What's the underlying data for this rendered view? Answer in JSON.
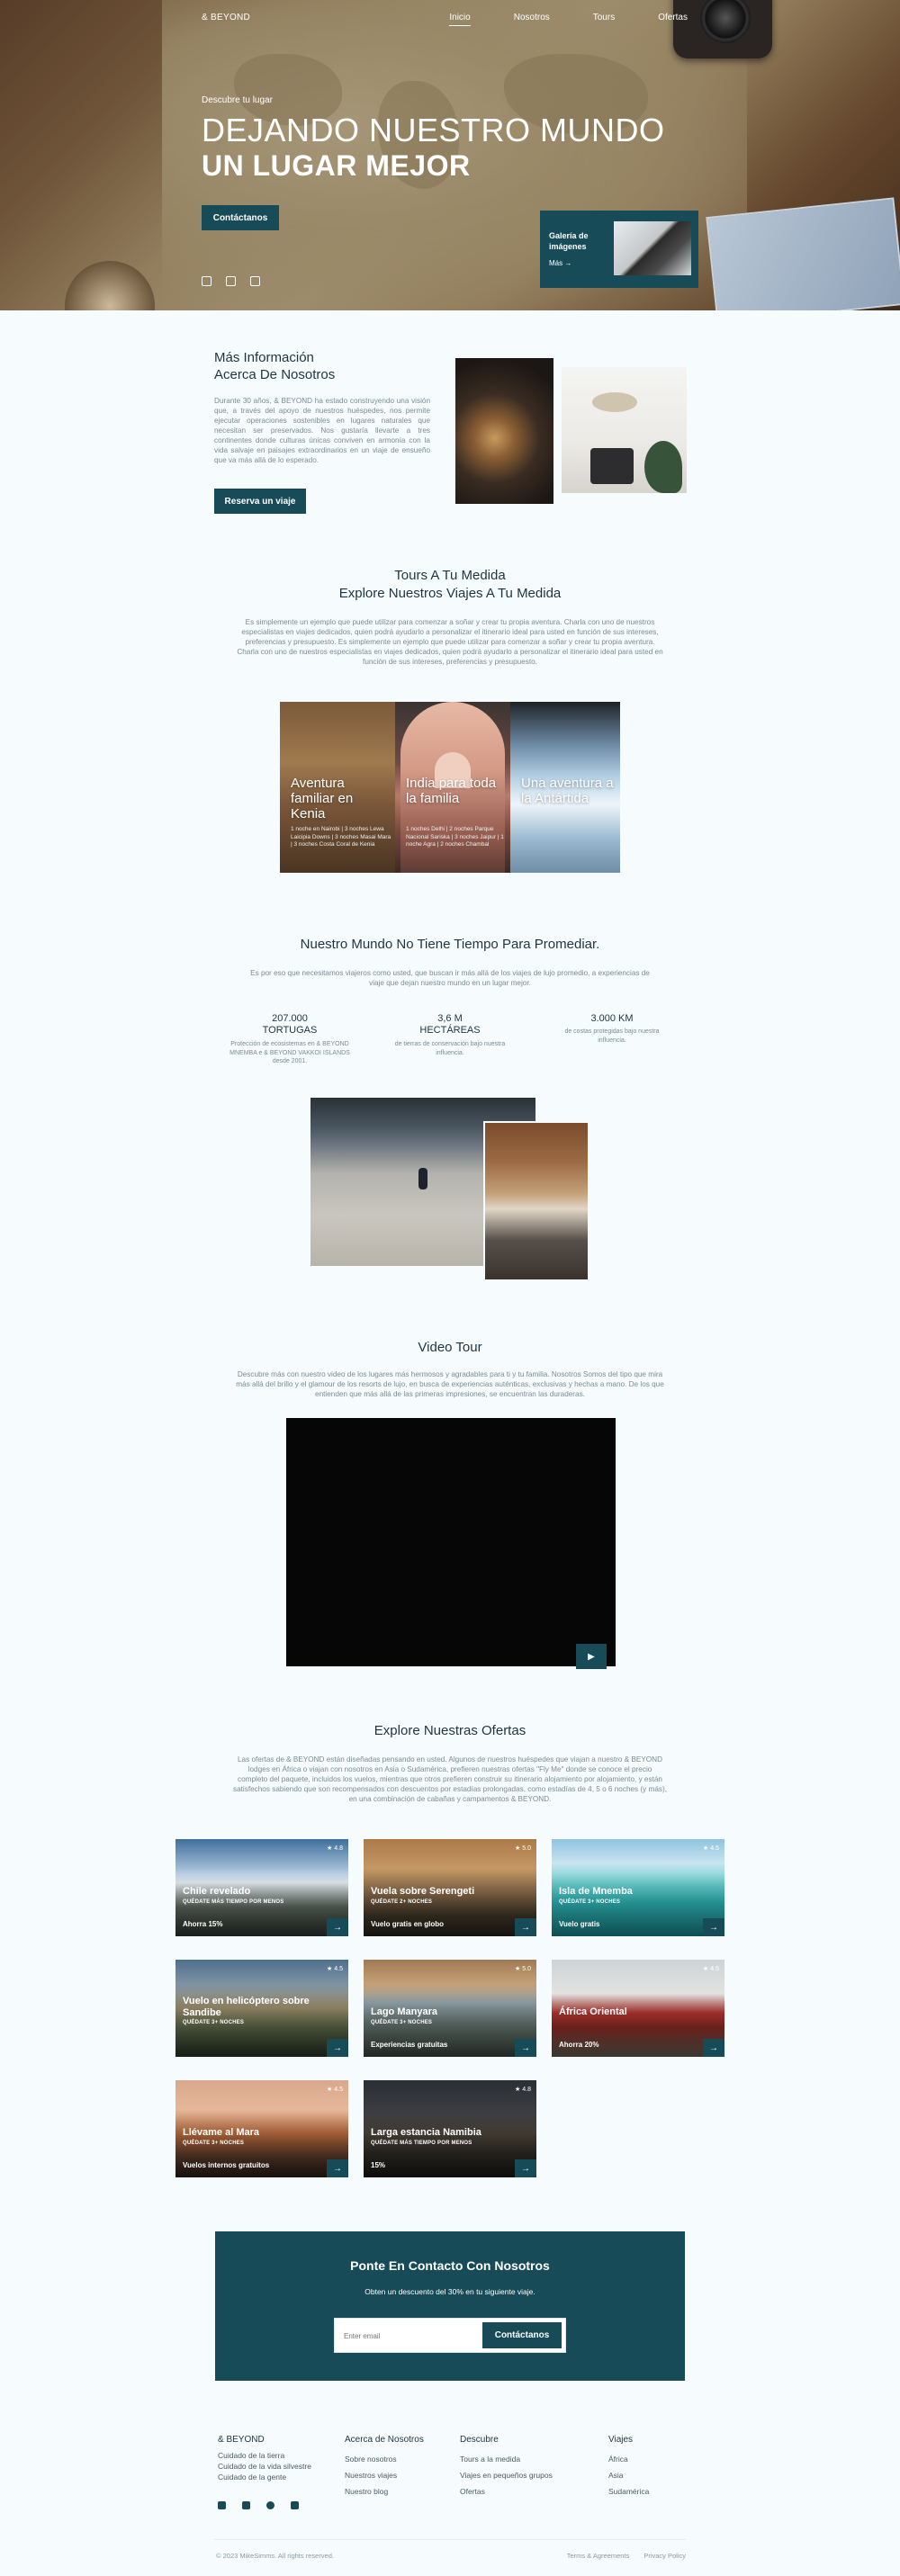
{
  "nav": {
    "brand": "& BEYOND",
    "links": [
      "Inicio",
      "Nosotros",
      "Tours",
      "Ofertas"
    ]
  },
  "hero": {
    "eyebrow": "Descubre tu lugar",
    "title_line1": "DEJANDO NUESTRO MUNDO",
    "title_line2": "UN LUGAR MEJOR",
    "cta": "Contáctanos",
    "gallery": {
      "title": "Galería de imágenes",
      "more": "Más  →"
    }
  },
  "about": {
    "title_line1": "Más Información",
    "title_line2": "Acerca De Nosotros",
    "text": "Durante 30 años, & BEYOND ha estado construyendo una visión que, a través del apoyo de nuestros huéspedes, nos permite ejecutar operaciones sostenibles en lugares naturales que necesitan ser preservados. Nos gustaría llevarte a tres continentes donde culturas únicas conviven en armonía con la vida salvaje en paisajes extraordinarios en un viaje de ensueño que va más allá de lo esperado.",
    "button": "Reserva un viaje"
  },
  "tours": {
    "title_line1": "Tours A Tu Medida",
    "title_line2": "Explore Nuestros Viajes A Tu Medida",
    "text": "Es simplemente un ejemplo que puede utilizar para comenzar a soñar y crear tu propia aventura. Charla con uno de nuestros especialistas en viajes dedicados, quien podrá ayudarlo a personalizar el itinerario ideal para usted en función de sus intereses, preferencias y presupuesto. Es simplemente un ejemplo que puede utilizar para comenzar a soñar y crear tu propia aventura. Charla con uno de nuestros especialistas en viajes dedicados, quien podrá ayudarlo a personalizar el itinerario ideal para usted en función de sus intereses, preferencias y presupuesto.",
    "cards": [
      {
        "title": "Aventura familiar en Kenia",
        "desc": "1 noche en Nairobi | 3 noches Lewa Laicipia Downs | 3 noches Masai Mara | 3 noches Costa Coral de Kenia"
      },
      {
        "title": "India para toda la familia",
        "desc": "1 noches Delhi | 2 noches Parque Nacional Sariska | 3 noches Jaipur | 1 noche Agra | 2 noches Chambal"
      },
      {
        "title": "Una aventura a la Antártida",
        "desc": ""
      }
    ]
  },
  "stats": {
    "title": "Nuestro Mundo No Tiene Tiempo Para Promediar.",
    "text": "Es por eso que necesitamos viajeros como usted, que buscan ir más allá de los viajes de lujo promedio, a experiencias de viaje que dejan nuestro mundo en un lugar mejor.",
    "items": [
      {
        "value": "207.000",
        "unit": "TORTUGAS",
        "desc": "Protección de ecosistemas en & BEYOND MNEMBA e & BEYOND VAKKOI ISLANDS desde 2001."
      },
      {
        "value": "3,6 M",
        "unit": "HECTÁREAS",
        "desc": "de tierras de conservación bajo nuestra influencia."
      },
      {
        "value": "3.000 KM",
        "unit": "",
        "desc": "de costas protegidas bajo nuestra influencia."
      }
    ]
  },
  "video": {
    "title": "Video Tour",
    "text": "Descubre más con nuestro video de los lugares más hermosos y agradables para ti y tu familia. Nosotros Somos del tipo que mira más allá del brillo y el glamour de los resorts de lujo, en busca de experiencias auténticas, exclusivas y hechas a mano. De los que entienden que más allá de las primeras impresiones, se encuentran las duraderas.",
    "play": "▶"
  },
  "offers": {
    "title": "Explore Nuestras Ofertas",
    "text": "Las ofertas de & BEYOND están diseñadas pensando en usted. Algunos de nuestros huéspedes que viajan a nuestro & BEYOND lodges en África o viajan con nosotros en Asia o Sudamérica, prefieren nuestras ofertas \"Fly Me\" donde se conoce el precio completo del paquete, incluidos los vuelos, mientras que otros prefieren construir su itinerario alojamiento por alojamiento, y están satisfechos sabiendo que son recompensados con descuentos por estadías prolongadas, como estadías de 4, 5 o 6 noches (y más), en una combinación de cabañas y campamentos & BEYOND.",
    "items": [
      {
        "rating": "★ 4.8",
        "title": "Chile revelado",
        "sub": "QUÉDATE MÁS TIEMPO POR MENOS",
        "price": "Ahorra 15%"
      },
      {
        "rating": "★ 5.0",
        "title": "Vuela sobre Serengeti",
        "sub": "QUÉDATE 2+ NOCHES",
        "price": "Vuelo gratis en globo"
      },
      {
        "rating": "★ 4.5",
        "title": "Isla de Mnemba",
        "sub": "QUÉDATE 3+ NOCHES",
        "price": "Vuelo gratis"
      },
      {
        "rating": "★ 4.5",
        "title": "Vuelo en helicóptero sobre Sandibe",
        "sub": "QUÉDATE 3+ NOCHES",
        "price": ""
      },
      {
        "rating": "★ 5.0",
        "title": "Lago Manyara",
        "sub": "QUÉDATE 3+ NOCHES",
        "price": "Experiencias gratuitas"
      },
      {
        "rating": "★ 4.5",
        "title": "África Oriental",
        "sub": "",
        "price": "Ahorra 20%"
      },
      {
        "rating": "★ 4.5",
        "title": "Llévame al Mara",
        "sub": "QUÉDATE 3+ NOCHES",
        "price": "Vuelos internos gratuitos"
      },
      {
        "rating": "★ 4.8",
        "title": "Larga estancia Namibia",
        "sub": "QUÉDATE MÁS TIEMPO POR MENOS",
        "price": "15%"
      }
    ]
  },
  "contact": {
    "title": "Ponte En Contacto Con Nosotros",
    "subtitle": "Obten un descuento del 30% en tu siguiente viaje.",
    "placeholder": "Enter email",
    "button": "Contáctanos"
  },
  "footer": {
    "brand": "& BEYOND",
    "brand_items": [
      "Cuidado de la tierra",
      "Cuidado de la vida silvestre",
      "Cuidado de la gente"
    ],
    "col2_title": "Acerca de Nosotros",
    "col2_items": [
      "Sobre nosotros",
      "Nuestros viajes",
      "Nuestro blog"
    ],
    "col3_title": "Descubre",
    "col3_items": [
      "Tours a la medida",
      "Viajes en pequeños grupos",
      "Ofertas"
    ],
    "col4_title": "Viajes",
    "col4_items": [
      "África",
      "Asia",
      "Sudamérica"
    ],
    "copyright": "© 2023 MikeSimms. All rights reserved.",
    "links": [
      "Terms & Agreements",
      "Privacy Policy"
    ]
  },
  "colors": {
    "accent": "#174b58",
    "background": "#f6fcfd",
    "text": "#1f3440",
    "muted": "#7a8b94"
  }
}
